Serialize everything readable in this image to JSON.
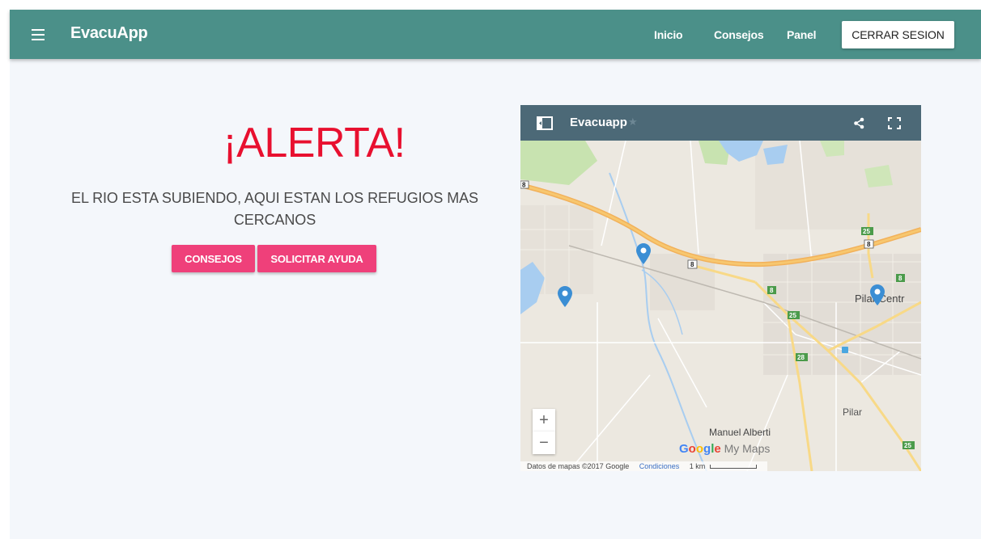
{
  "navbar": {
    "brand": "EvacuApp",
    "links": [
      "Inicio",
      "Consejos",
      "Panel"
    ],
    "logout": "CERRAR SESION",
    "color": "#4b9089"
  },
  "alert": {
    "title": "¡ALERTA!",
    "message": "EL RIO ESTA SUBIENDO, AQUI ESTAN LOS REFUGIOS MAS CERCANOS",
    "buttons": [
      "CONSEJOS",
      "SOLICITAR AYUDA"
    ],
    "title_color": "#e8102f",
    "button_color": "#ef407a"
  },
  "map": {
    "title": "Evacuapp",
    "star": "★",
    "zoom_in": "+",
    "zoom_out": "−",
    "labels": {
      "pilar_centro": "Pilar Centr",
      "pilar": "Pilar",
      "manuel_alberti": "Manuel Alberti"
    },
    "google_logo": [
      "G",
      "o",
      "o",
      "g",
      "l",
      "e"
    ],
    "my_maps": "My Maps",
    "attribution": "Datos de mapas ©2017 Google",
    "terms": "Condiciones",
    "scale": "1 km",
    "route_shields": [
      "8",
      "8",
      "8",
      "8",
      "25",
      "25",
      "28",
      "8",
      "25"
    ],
    "pin_color": "#3b8ed4"
  }
}
